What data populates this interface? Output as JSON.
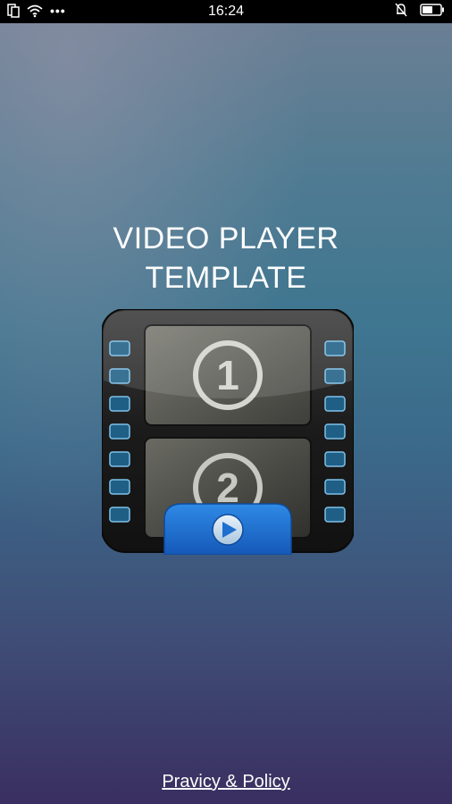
{
  "status_bar": {
    "time": "16:24",
    "dots": "•••",
    "icons": [
      "sim-card-icon",
      "wifi-icon",
      "more-dots-icon",
      "notifications-off-icon",
      "battery-icon"
    ]
  },
  "app": {
    "title_line1": "VIDEO PLAYER",
    "title_line2": "TEMPLATE",
    "frame1_number": "1",
    "frame2_number": "2",
    "privacy_link": "Pravicy & Policy"
  },
  "colors": {
    "play_tab": "#1e6fd0",
    "film_body": "#1c1c1c",
    "sprocket": "#5aa9d8"
  }
}
